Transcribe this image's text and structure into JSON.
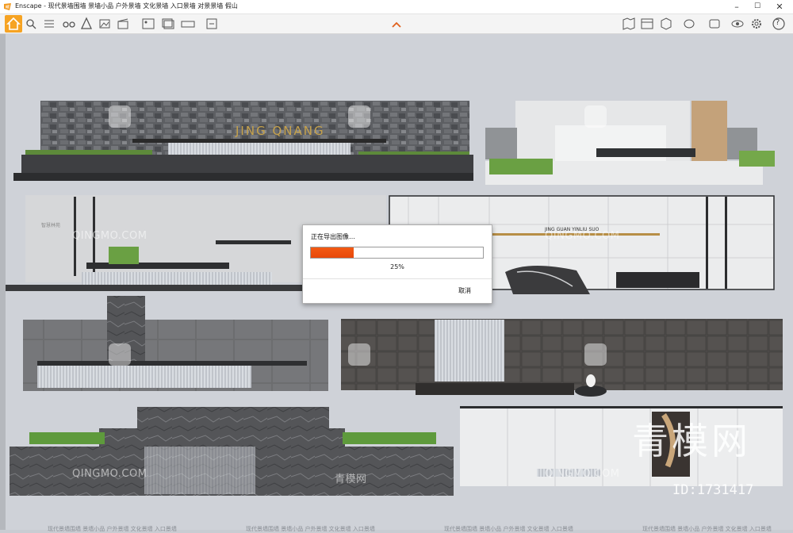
{
  "window": {
    "title": "Enscape - 现代景墙围墙 景墙小品 户外景墙 文化景墙 入口景墙 对景景墙 假山",
    "minimize": "–",
    "maximize": "☐",
    "close": "✕"
  },
  "toolbar": {
    "left_icons": [
      "home-icon",
      "lightbulb-icon",
      "list-icon",
      "binoculars-icon",
      "cube-icon",
      "landscape-icon",
      "text-icon",
      "clapboard-icon",
      "image-export-icon",
      "batch-export-icon",
      "panorama-export-icon",
      "exe-export-icon"
    ],
    "center_icon": "chevron-up-icon",
    "right_icons": [
      "map-icon",
      "asset-library-icon",
      "cube-box-icon",
      "paint-icon",
      "visual-settings-icon",
      "eye-icon",
      "gear-icon",
      "help-icon"
    ],
    "help_label": "?"
  },
  "dialog": {
    "title": "正在导出图像…",
    "progress": 25,
    "percent_label": "25%",
    "cancel_label": "取消",
    "accent_color": "#f0540e"
  },
  "scene": {
    "sign_text_1": "JING QNANG",
    "sign_text_2": "JING GUAN YINLIU SUO",
    "panel_text": "智慧林苑"
  },
  "watermarks": {
    "site": "QINGMO.COM",
    "cn_small": "青模网",
    "cn_big": "青模网",
    "id": "ID:1731417"
  },
  "bottom": {
    "text": "现代景墙围墙 景墙小品 户外景墙 文化景墙 入口景墙"
  }
}
